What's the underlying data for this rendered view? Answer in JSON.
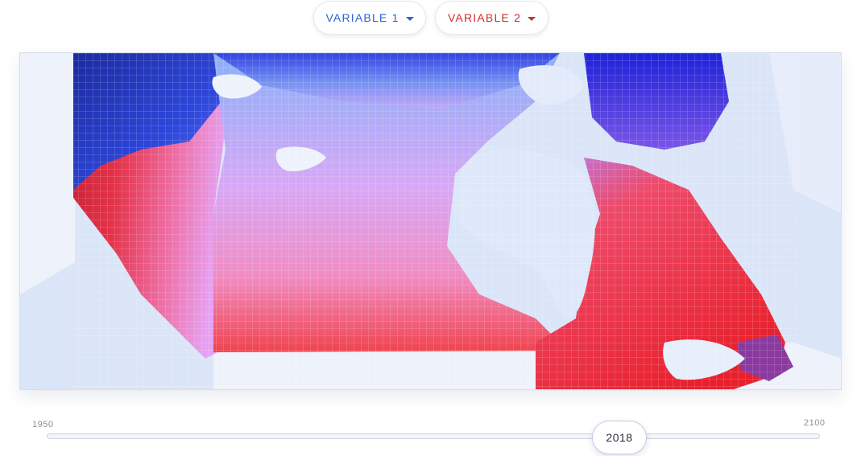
{
  "controls": {
    "variable1": {
      "label": "VARIABLE 1",
      "color": "#2a63d6"
    },
    "variable2": {
      "label": "VARIABLE 2",
      "color": "#d42a2a"
    }
  },
  "map": {
    "color_scale": {
      "low": "#1f2fd9",
      "mid": "#e8a0f5",
      "high": "#e61f2e"
    },
    "water_color": "#dde6f8",
    "land_outside_color": "#eef2fb",
    "grid_overlay": true
  },
  "timeline": {
    "start_year": "1950",
    "end_year": "2100",
    "current_year": "2018"
  }
}
